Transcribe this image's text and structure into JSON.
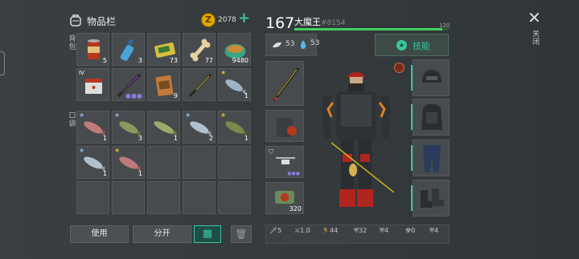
{
  "inventory": {
    "title": "物品栏",
    "coins": "2078",
    "section_top": "背包",
    "section_bottom": "口袋",
    "slots_row1": [
      {
        "icon": "canned-food",
        "count": "5"
      },
      {
        "icon": "water-bottle",
        "count": "3"
      },
      {
        "icon": "battery-pack",
        "count": "73"
      },
      {
        "icon": "bone",
        "count": "77"
      },
      {
        "icon": "bowl-of-food",
        "count": "9480"
      }
    ],
    "slots_row2": [
      {
        "icon": "crafting-box",
        "badge": "IV"
      },
      {
        "icon": "rifle",
        "count": ""
      },
      {
        "icon": "seed-bag",
        "count": "9"
      },
      {
        "icon": "fishing-rod",
        "count": ""
      },
      {
        "icon": "fish",
        "count": "1"
      }
    ],
    "fish_row1": [
      {
        "icon": "fish",
        "count": "1"
      },
      {
        "icon": "fish",
        "count": "3"
      },
      {
        "icon": "fish",
        "count": "1"
      },
      {
        "icon": "fish",
        "count": "2"
      },
      {
        "icon": "fish",
        "count": "1"
      }
    ],
    "fish_row2": [
      {
        "icon": "fish",
        "count": "1"
      },
      {
        "icon": "fish",
        "count": "1"
      }
    ],
    "buttons": {
      "use": "使用",
      "split": "分开"
    }
  },
  "player": {
    "level": "167",
    "name": "大魔王",
    "id": "#8154",
    "xp_max": "120",
    "xp_fill": 0.96,
    "food": "53",
    "water": "53",
    "skills": "技能"
  },
  "equipment": {
    "hand_count": "320",
    "stats": [
      "5",
      "1.0",
      "44",
      "32",
      "4",
      "0",
      "4"
    ]
  },
  "close": {
    "label": "关闭"
  },
  "colors": {
    "accent": "#39c7a0",
    "xp": "#40d060",
    "coin": "#e0a800"
  }
}
